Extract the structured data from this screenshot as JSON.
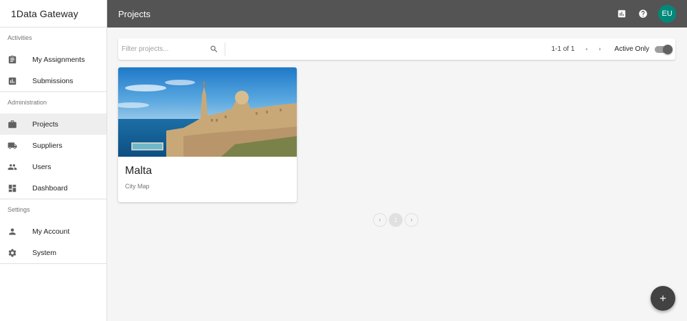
{
  "app": {
    "title": "1Data Gateway"
  },
  "sidebar": {
    "sections": [
      {
        "title": "Activities",
        "items": [
          {
            "label": "My Assignments",
            "icon": "assignment-icon"
          },
          {
            "label": "Submissions",
            "icon": "bar-chart-icon"
          }
        ]
      },
      {
        "title": "Administration",
        "items": [
          {
            "label": "Projects",
            "icon": "briefcase-icon",
            "active": true
          },
          {
            "label": "Suppliers",
            "icon": "truck-icon"
          },
          {
            "label": "Users",
            "icon": "people-icon"
          },
          {
            "label": "Dashboard",
            "icon": "dashboard-icon"
          }
        ]
      },
      {
        "title": "Settings",
        "items": [
          {
            "label": "My Account",
            "icon": "person-icon"
          },
          {
            "label": "System",
            "icon": "gear-icon"
          }
        ]
      }
    ]
  },
  "header": {
    "title": "Projects",
    "avatar_initials": "EU",
    "avatar_color": "#00897b",
    "bar_color": "#545454"
  },
  "filter": {
    "placeholder": "Filter projects...",
    "value": "",
    "paging_text": "1-1 of 1",
    "active_only_label": "Active Only",
    "active_only": true
  },
  "projects": [
    {
      "title": "Malta",
      "subtitle": "City Map"
    }
  ],
  "pagination": {
    "current_page": "1"
  }
}
